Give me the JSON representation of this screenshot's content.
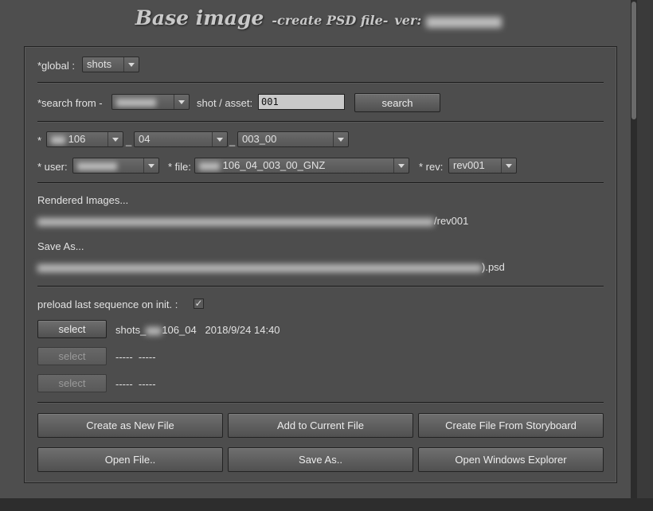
{
  "title": {
    "main": "Base image",
    "sub": "-create PSD file-",
    "ver_label": "ver:"
  },
  "global": {
    "label": "*global :",
    "value": "shots"
  },
  "search": {
    "from_label": "*search from -",
    "asset_label": "shot / asset:",
    "asset_value": "001",
    "button": "search"
  },
  "shot": {
    "star": "*",
    "seq": "106",
    "sep1": "_",
    "cut": "04",
    "sep2": "_",
    "take": "003_00"
  },
  "user": {
    "label": "* user:",
    "file_label": "* file:",
    "file_value": "106_04_003_00_GNZ",
    "rev_label": "* rev:",
    "rev_value": "rev001"
  },
  "rendered": {
    "label": "Rendered Images...",
    "path_suffix": "/rev001"
  },
  "save_as": {
    "label": "Save As...",
    "path_suffix": ").psd"
  },
  "preload": {
    "label": "preload last sequence on init. :",
    "checked": "✓"
  },
  "history": [
    {
      "button": "select",
      "text_a": "shots_",
      "text_b": "106_04",
      "date": "2018/9/24 14:40"
    },
    {
      "button": "select",
      "text_a": "-----",
      "text_b": "-----"
    },
    {
      "button": "select",
      "text_a": "-----",
      "text_b": "-----"
    }
  ],
  "actions": {
    "create_new": "Create as New File",
    "add_current": "Add to Current File",
    "from_storyboard": "Create File From Storyboard",
    "open_file": "Open File..",
    "save_as": "Save As..",
    "open_explorer": "Open Windows Explorer"
  }
}
